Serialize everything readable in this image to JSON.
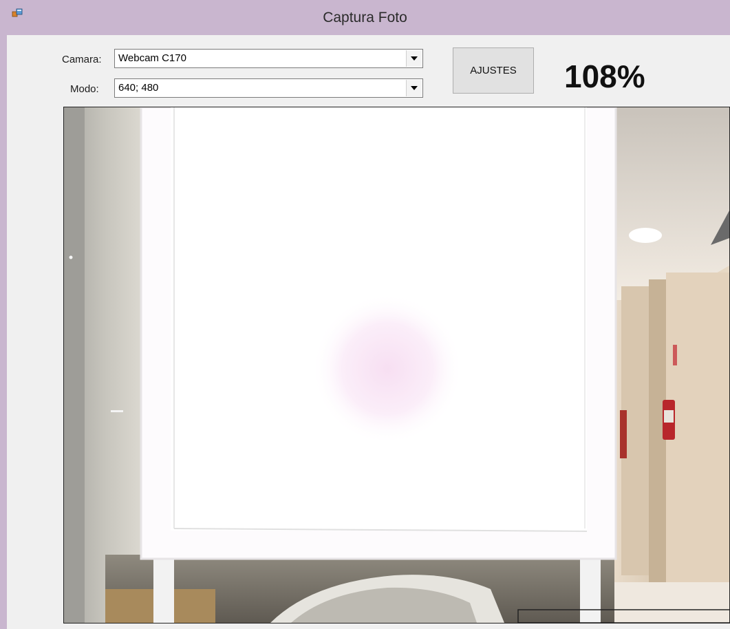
{
  "window": {
    "title": "Captura Foto",
    "icon": "app-window-icon"
  },
  "form": {
    "camera_label": "Camara:",
    "camera_value": "Webcam C170",
    "mode_label": "Modo:",
    "mode_value": "640; 480",
    "settings_button": "AJUSTES",
    "zoom_percent": "108%"
  },
  "preview": {
    "description_icon": "camera-preview"
  }
}
